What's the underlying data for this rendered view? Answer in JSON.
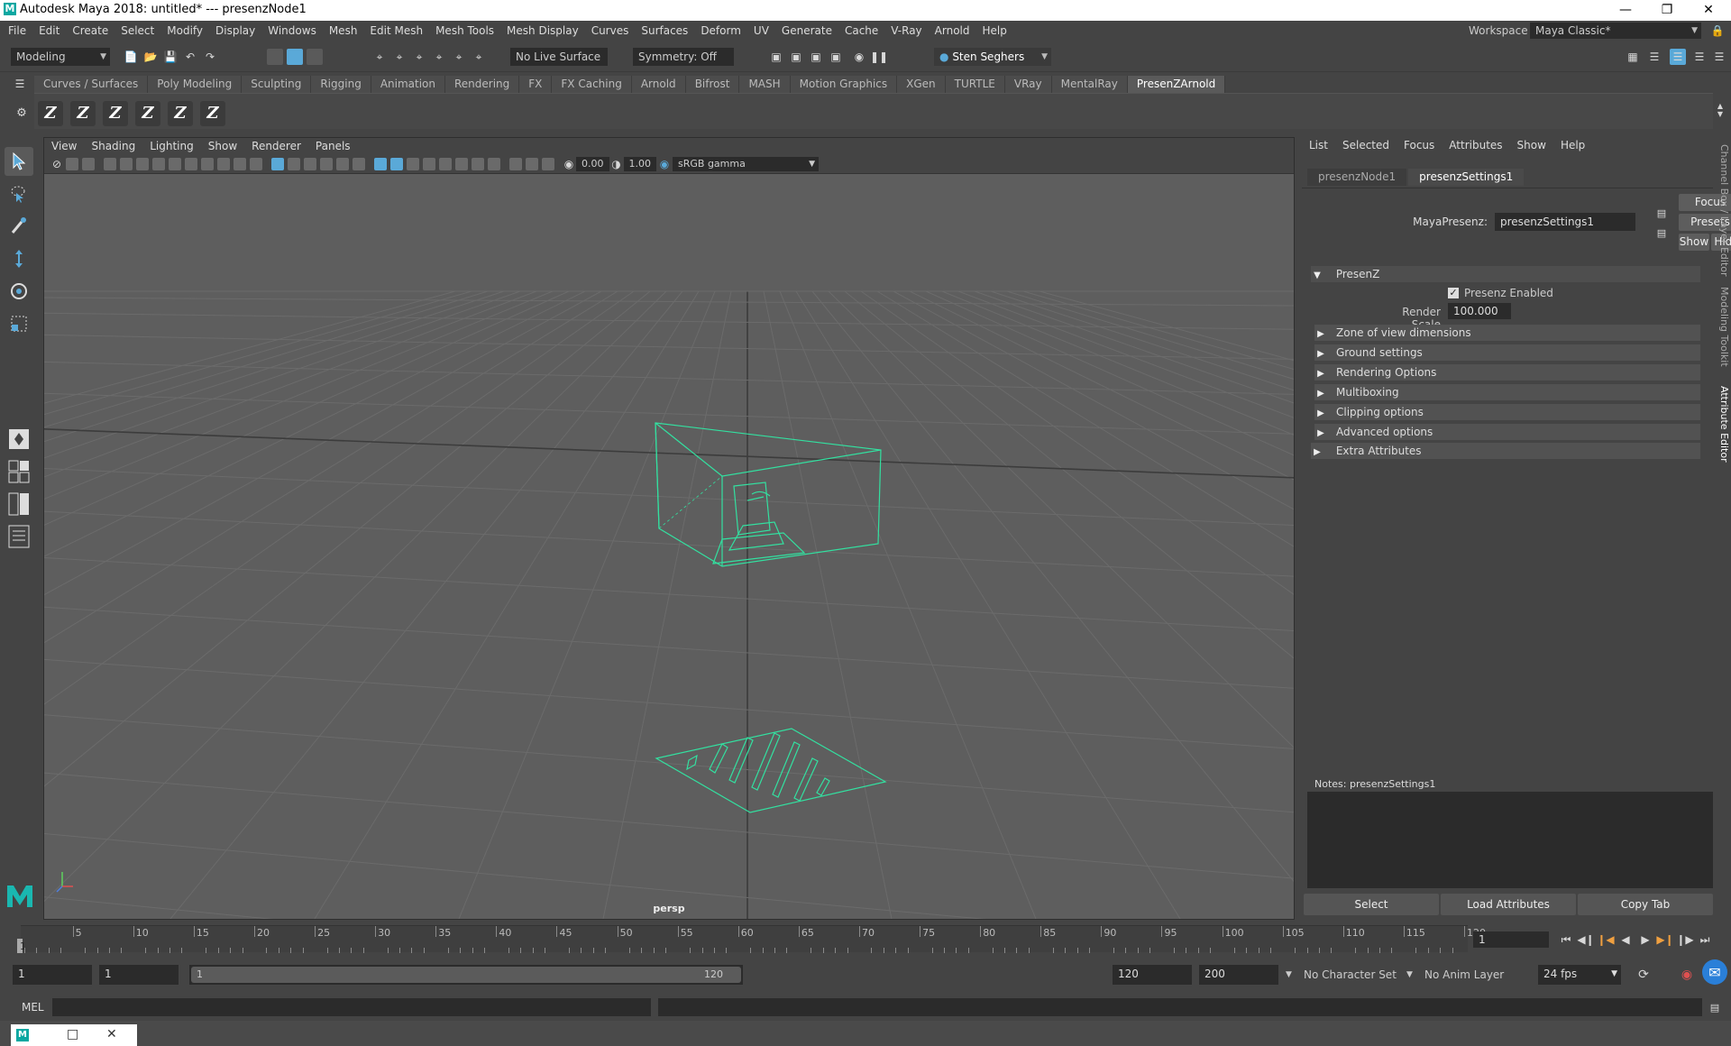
{
  "window": {
    "title": "Autodesk Maya 2018: untitled*   ---   presenzNode1",
    "logo_letter": "M"
  },
  "menubar": {
    "items": [
      "File",
      "Edit",
      "Create",
      "Select",
      "Modify",
      "Display",
      "Windows",
      "Mesh",
      "Edit Mesh",
      "Mesh Tools",
      "Mesh Display",
      "Curves",
      "Surfaces",
      "Deform",
      "UV",
      "Generate",
      "Cache",
      "V-Ray",
      "Arnold",
      "Help"
    ],
    "workspace_label": "Workspace :",
    "workspace_value": "Maya Classic*"
  },
  "statusline": {
    "menuset": "Modeling",
    "live_surface": "No Live Surface",
    "symmetry": "Symmetry: Off",
    "user": "Sten Seghers"
  },
  "shelf": {
    "tabs": [
      "Curves / Surfaces",
      "Poly Modeling",
      "Sculpting",
      "Rigging",
      "Animation",
      "Rendering",
      "FX",
      "FX Caching",
      "Arnold",
      "Bifrost",
      "MASH",
      "Motion Graphics",
      "XGen",
      "TURTLE",
      "VRay",
      "MentalRay",
      "PresenZArnold"
    ],
    "active_tab": "PresenZArnold",
    "icons": [
      "Z",
      "Z",
      "Z",
      "Z",
      "Z",
      "Z"
    ]
  },
  "viewport": {
    "menu": [
      "View",
      "Shading",
      "Lighting",
      "Show",
      "Renderer",
      "Panels"
    ],
    "exposure": "0.00",
    "gamma": "1.00",
    "color_space": "sRGB gamma",
    "camera_label": "persp",
    "wire_color": "#33e0a0",
    "bg_color": "#5e5e5e",
    "grid_color": "#6b6b6b"
  },
  "attribute_editor": {
    "menu": [
      "List",
      "Selected",
      "Focus",
      "Attributes",
      "Show",
      "Help"
    ],
    "tabs": [
      "presenzNode1",
      "presenzSettings1"
    ],
    "active_tab": "presenzSettings1",
    "node_label": "MayaPresenz:",
    "node_name": "presenzSettings1",
    "buttons": {
      "focus": "Focus",
      "presets": "Presets",
      "show": "Show",
      "hide": "Hide"
    },
    "section_presenz": "PresenZ",
    "presenz_enabled_label": "Presenz Enabled",
    "presenz_enabled": true,
    "render_scale_label": "Render Scale",
    "render_scale": "100.000",
    "frames": [
      "Zone of view dimensions",
      "Ground settings",
      "Rendering Options",
      "Multiboxing",
      "Clipping options",
      "Advanced options"
    ],
    "extra_attributes": "Extra Attributes",
    "notes_label": "Notes:  presenzSettings1",
    "bottom_buttons": {
      "select": "Select",
      "load": "Load Attributes",
      "copy": "Copy Tab"
    },
    "side_tabs": [
      "Channel Box / Layer Editor",
      "Modeling Toolkit",
      "Attribute Editor"
    ]
  },
  "timeslider": {
    "labels": [
      "5",
      "10",
      "15",
      "20",
      "25",
      "30",
      "35",
      "40",
      "45",
      "50",
      "55",
      "60",
      "65",
      "70",
      "75",
      "80",
      "85",
      "90",
      "95",
      "100",
      "105",
      "110",
      "115",
      "120"
    ],
    "current_marker": "1",
    "current_frame": "1"
  },
  "range": {
    "start": "1",
    "playback_start": "1",
    "slider_start": "1",
    "slider_end": "120",
    "playback_end": "120",
    "end": "200",
    "character_set": "No Character Set",
    "anim_layer": "No Anim Layer",
    "fps": "24 fps"
  },
  "cmdline": {
    "label": "MEL"
  }
}
